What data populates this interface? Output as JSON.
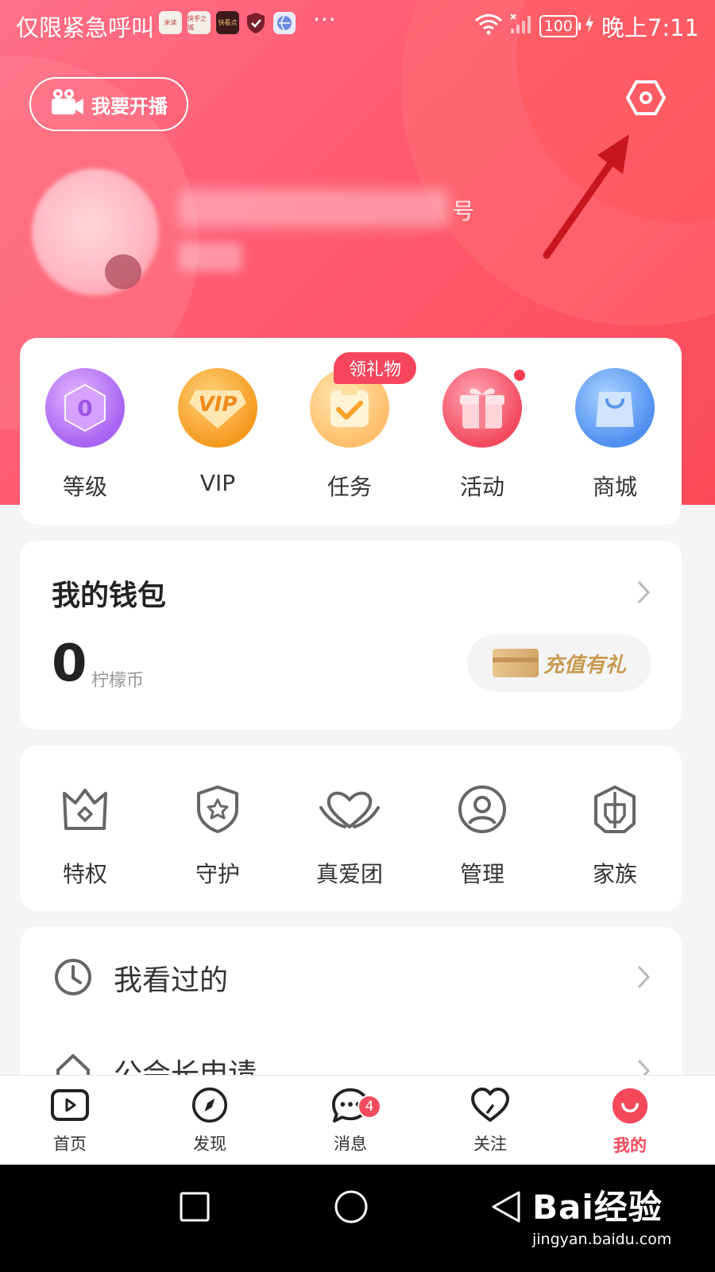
{
  "status_bar": {
    "left_text": "仅限紧急呼叫",
    "apps": [
      "米读",
      "快手之城",
      "快看点"
    ],
    "more": "···",
    "battery": "100",
    "time": "晚上7:11"
  },
  "header": {
    "live_button": "我要开播",
    "profile_suffix": "号"
  },
  "quick_entries": {
    "gift_tag": "领礼物",
    "level_value": "0",
    "vip_text": "VIP",
    "items": [
      {
        "label": "等级",
        "icon": "level-icon"
      },
      {
        "label": "VIP",
        "icon": "vip-icon"
      },
      {
        "label": "任务",
        "icon": "task-icon"
      },
      {
        "label": "活动",
        "icon": "gift-box-icon"
      },
      {
        "label": "商城",
        "icon": "shopping-bag-icon"
      }
    ]
  },
  "wallet": {
    "title": "我的钱包",
    "amount": "0",
    "unit": "柠檬币",
    "recharge_label": "充值有礼"
  },
  "features": {
    "items": [
      {
        "label": "特权",
        "icon": "crown-icon"
      },
      {
        "label": "守护",
        "icon": "shield-star-icon"
      },
      {
        "label": "真爱团",
        "icon": "heart-hands-icon"
      },
      {
        "label": "管理",
        "icon": "user-circle-icon"
      },
      {
        "label": "家族",
        "icon": "helmet-icon"
      }
    ]
  },
  "list": {
    "items": [
      {
        "label": "我看过的",
        "icon": "clock-icon"
      },
      {
        "label": "公会长申请",
        "icon": "house-icon"
      }
    ]
  },
  "bottom_nav": {
    "items": [
      {
        "label": "首页",
        "icon": "play-tv-icon"
      },
      {
        "label": "发现",
        "icon": "compass-icon"
      },
      {
        "label": "消息",
        "icon": "chat-bubble-icon",
        "badge": "4"
      },
      {
        "label": "关注",
        "icon": "heart-icon"
      },
      {
        "label": "我的",
        "icon": "smile-face-icon",
        "active": true
      }
    ]
  },
  "watermark": {
    "brand": "Bai经验",
    "url": "jingyan.baidu.com"
  },
  "colors": {
    "accent": "#f5485a",
    "hero_start": "#ff6f86",
    "hero_end": "#fb4b57"
  }
}
